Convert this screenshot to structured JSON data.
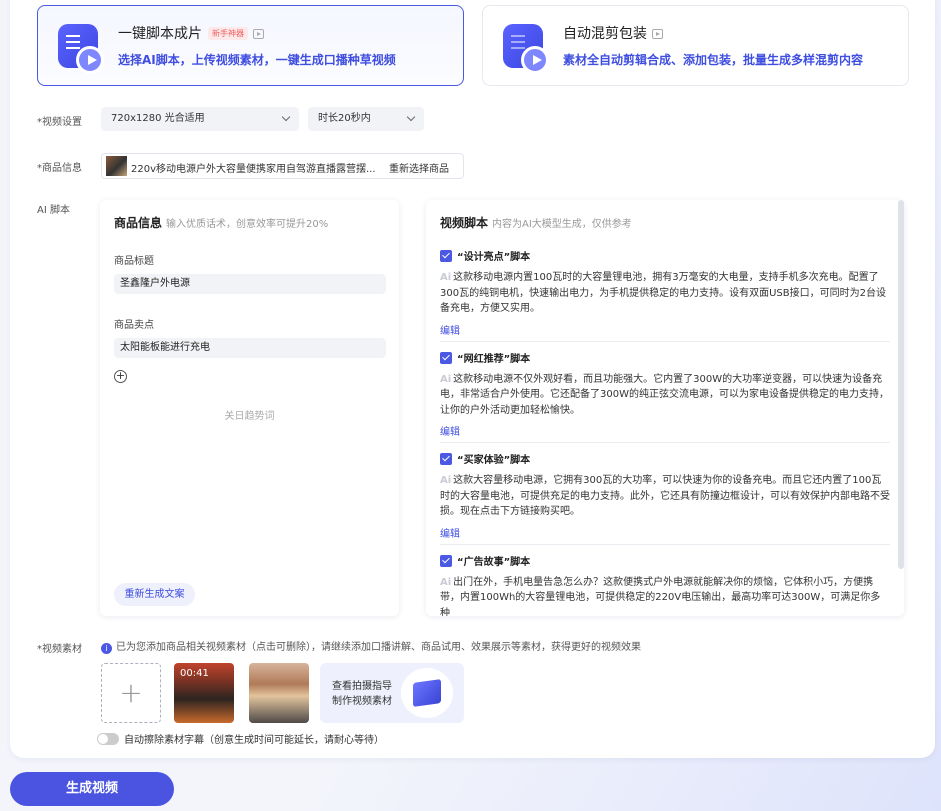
{
  "modes": [
    {
      "title": "一键脚本成片",
      "badge": "新手神器",
      "subtitle": "选择AI脚本，上传视频素材，一键生成口播种草视频",
      "active": true
    },
    {
      "title": "自动混剪包装",
      "badge": "",
      "subtitle": "素材全自动剪辑合成、添加包装，批量生成多样混剪内容",
      "active": false
    }
  ],
  "settings": {
    "label": "*视频设置",
    "resolution": "720x1280 光合适用",
    "duration": "时长20秒内"
  },
  "product": {
    "label": "*商品信息",
    "name": "220v移动电源户外大容量便携家用自驾游直播露营摆...",
    "reselect": "重新选择商品"
  },
  "ai_script": {
    "label": "AI 脚本",
    "product_card": {
      "title": "商品信息",
      "hint": "输入优质话术，创意效率可提升20%",
      "title_label": "商品标题",
      "title_value": "圣鑫隆户外电源",
      "selling_label": "商品卖点",
      "selling_value": "太阳能板能进行充电",
      "keyword_link": "关日趋势词",
      "regen_button": "重新生成文案"
    },
    "script_card": {
      "title": "视频脚本",
      "hint": "内容为AI大模型生成，仅供参考",
      "ai_tag": "Ai",
      "edit_label": "编辑",
      "items": [
        {
          "title": "“设计亮点”脚本",
          "text": "这款移动电源内置100瓦时的大容量锂电池，拥有3万毫安的大电量，支持手机多次充电。配置了300瓦的纯铜电机，快速输出电力，为手机提供稳定的电力支持。设有双面USB接口，可同时为2台设备充电，方便又实用。"
        },
        {
          "title": "“网红推荐”脚本",
          "text": "这款移动电源不仅外观好看，而且功能强大。它内置了300W的大功率逆变器，可以快速为设备充电，非常适合户外使用。它还配备了300W的纯正弦交流电源，可以为家电设备提供稳定的电力支持，让你的户外活动更加轻松愉快。"
        },
        {
          "title": "“买家体验”脚本",
          "text": "这款大容量移动电源，它拥有300瓦的大功率，可以快速为你的设备充电。而且它还内置了100瓦时的大容量电池，可提供充足的电力支持。此外，它还具有防撞边框设计，可以有效保护内部电路不受损。现在点击下方链接购买吧。"
        },
        {
          "title": "“广告故事”脚本",
          "text": "出门在外，手机电量告急怎么办？这款便携式户外电源就能解决你的烦恼，它体积小巧，方便携带，内置100Wh的大容量锂电池，可提供稳定的220V电压输出，最高功率可达300W，可满足你多种"
        }
      ]
    }
  },
  "material": {
    "label": "*视频素材",
    "note": "已为您添加商品相关视频素材（点击可删除），请继续添加口播讲解、商品试用、效果展示等素材，获得更好的视频效果",
    "add_symbol": "+",
    "thumb_duration": "00:41",
    "guide_line1": "查看拍摄指导",
    "guide_line2": "制作视频素材",
    "toggle_label": "自动擦除素材字幕（创意生成时间可能延长，请耐心等待）"
  },
  "generate_button": "生成视频",
  "colors": {
    "accent": "#4a58e4",
    "badge": "#f06060"
  }
}
